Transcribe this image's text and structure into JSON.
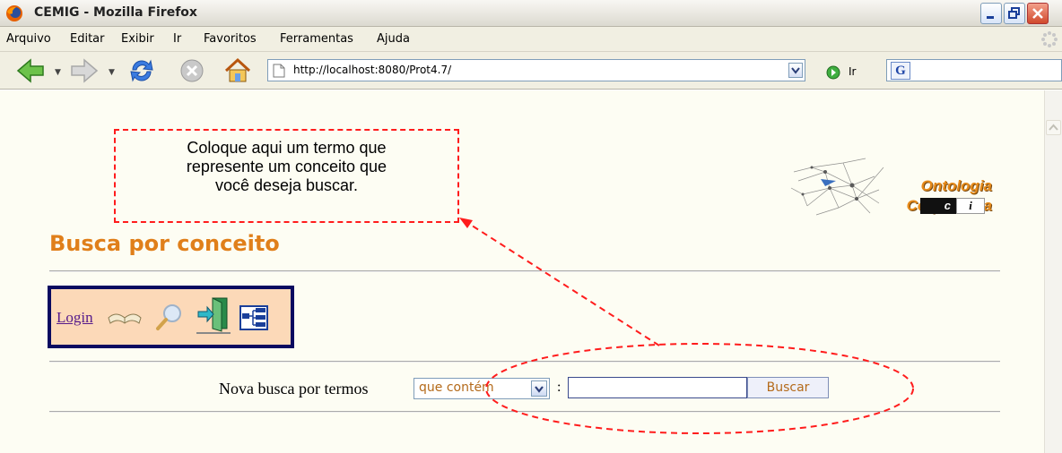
{
  "window": {
    "title": "CEMIG - Mozilla Firefox"
  },
  "menubar": {
    "items": [
      "Arquivo",
      "Editar",
      "Exibir",
      "Ir",
      "Favoritos",
      "Ferramentas",
      "Ajuda"
    ]
  },
  "navbar": {
    "url": "http://localhost:8080/Prot4.7/",
    "go_label": "Ir",
    "search_engine_icon": "G"
  },
  "annotation": {
    "callout_lines": [
      "Coloque aqui um termo que",
      "represente um conceito que",
      "você deseja buscar."
    ],
    "accent_color": "#ff1c1c"
  },
  "logo": {
    "line1": "Ontologia",
    "line2": "Corporativa",
    "c": "c",
    "i": "i"
  },
  "page": {
    "title": "Busca por conceito",
    "title_color": "#e07f1a"
  },
  "toolbox": {
    "login_label": "Login",
    "icons": [
      "book-icon",
      "magnifier-icon",
      "exit-door-icon",
      "tree-view-icon"
    ]
  },
  "search": {
    "label": "Nova busca por termos",
    "select_value": "que contém",
    "colon": ":",
    "input_value": "",
    "button_label": "Buscar"
  }
}
